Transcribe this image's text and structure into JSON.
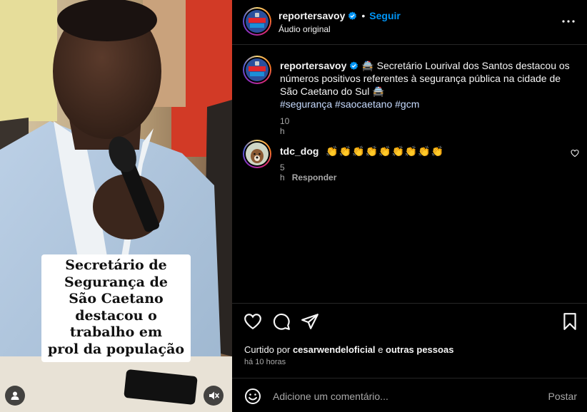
{
  "media": {
    "overlay_caption": [
      "Secretário de",
      "Segurança de",
      "São Caetano",
      "destacou o",
      "trabalho em",
      "prol da população"
    ],
    "user_icon": "person-icon",
    "mute_icon": "speaker-muted-icon"
  },
  "header": {
    "username": "reportersavoy",
    "separator": "•",
    "follow_label": "Seguir",
    "audio_label": "Áudio original",
    "avatar_text_top": "REPORTER",
    "avatar_text_bottom": "SAVOY"
  },
  "caption": {
    "username": "reportersavoy",
    "text": "🚔 Secretário Lourival dos Santos destacou os números positivos referentes à segurança pública na cidade de São Caetano do Sul 🚔",
    "hashtags": "#segurança #saocaetano #gcm",
    "age": "10 h"
  },
  "comments": [
    {
      "username": "tdc_dog",
      "text": "👏👏👏👏👏👏👏👏👏",
      "age": "5 h",
      "reply_label": "Responder"
    }
  ],
  "actions": {
    "icons": [
      "heart-icon",
      "comment-icon",
      "share-icon",
      "bookmark-icon"
    ]
  },
  "likes": {
    "prefix": "Curtido por",
    "user": "cesarwendeloficial",
    "joiner": "e",
    "others": "outras pessoas"
  },
  "post_age": "há 10 horas",
  "comment_bar": {
    "placeholder": "Adicione um comentário...",
    "post_label": "Postar"
  },
  "colors": {
    "background": "#000000",
    "link_blue": "#0095f6",
    "secondary_text": "#a8a8a8",
    "hashtag": "#c7dbff"
  }
}
